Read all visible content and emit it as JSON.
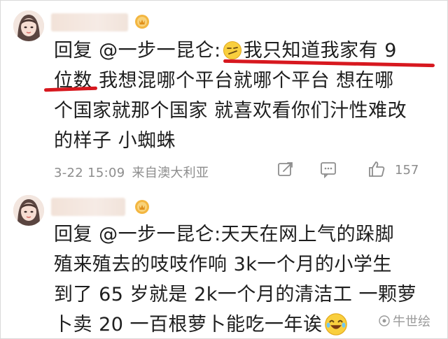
{
  "comments": [
    {
      "lines": [
        "回复 @一步一昆仑:",
        "我只知道我家有 9",
        "位数",
        "我想混哪个平台就哪个平台 想在哪",
        "个国家就那个国家 就喜欢看你们汁性难改",
        "的样子 小蜘蛛"
      ],
      "meta": {
        "time": "3-22 15:09",
        "source": "来自澳大利亚",
        "likes": "157"
      }
    },
    {
      "lines": [
        "回复 @一步一昆仑:天天在网上气的跺脚",
        "殖来殖去的吱吱作响 3k一个月的小学生",
        "到了 65 岁就是 2k一个月的清洁工 一颗萝",
        "卜卖 20 一百根萝卜能吃一年诶"
      ]
    }
  ],
  "watermark": "牛世绘",
  "icons": {
    "badge": "gold-badge-icon",
    "emoji_smirk": "smirk-emoji-icon",
    "emoji_laugh": "laugh-emoji-icon",
    "share": "share-icon",
    "comment": "comment-icon",
    "like": "thumbs-up-icon"
  },
  "colors": {
    "marker": "#d7181f",
    "meta": "#8d8d8d",
    "text": "#1e1e1e"
  }
}
